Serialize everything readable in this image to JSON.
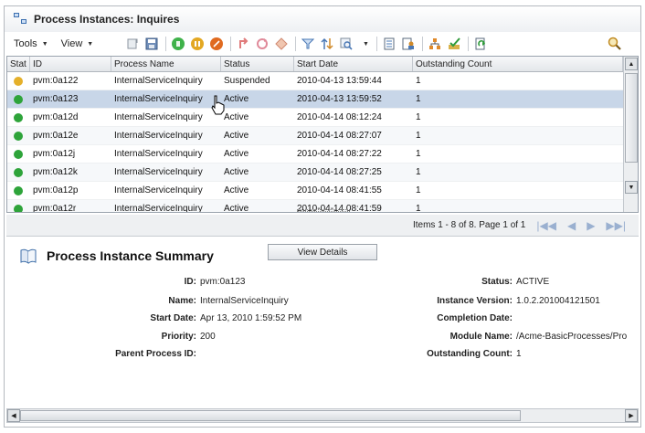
{
  "window": {
    "title": "Process Instances: Inquires"
  },
  "toolbar": {
    "tools_label": "Tools",
    "view_label": "View"
  },
  "grid": {
    "columns": [
      "Stat",
      "ID",
      "Process Name",
      "Status",
      "Start Date",
      "Outstanding Count"
    ],
    "rows": [
      {
        "id": "pvm:0a122",
        "name": "InternalServiceInquiry",
        "status": "Suspended",
        "start": "2010-04-13 13:59:44",
        "count": "1",
        "color": "#e5b02a"
      },
      {
        "id": "pvm:0a123",
        "name": "InternalServiceInquiry",
        "status": "Active",
        "start": "2010-04-13 13:59:52",
        "count": "1",
        "color": "#2ea43a"
      },
      {
        "id": "pvm:0a12d",
        "name": "InternalServiceInquiry",
        "status": "Active",
        "start": "2010-04-14 08:12:24",
        "count": "1",
        "color": "#2ea43a"
      },
      {
        "id": "pvm:0a12e",
        "name": "InternalServiceInquiry",
        "status": "Active",
        "start": "2010-04-14 08:27:07",
        "count": "1",
        "color": "#2ea43a"
      },
      {
        "id": "pvm:0a12j",
        "name": "InternalServiceInquiry",
        "status": "Active",
        "start": "2010-04-14 08:27:22",
        "count": "1",
        "color": "#2ea43a"
      },
      {
        "id": "pvm:0a12k",
        "name": "InternalServiceInquiry",
        "status": "Active",
        "start": "2010-04-14 08:27:25",
        "count": "1",
        "color": "#2ea43a"
      },
      {
        "id": "pvm:0a12p",
        "name": "InternalServiceInquiry",
        "status": "Active",
        "start": "2010-04-14 08:41:55",
        "count": "1",
        "color": "#2ea43a"
      },
      {
        "id": "pvm:0a12r",
        "name": "InternalServiceInquiry",
        "status": "Active",
        "start": "2010-04-14 08:41:59",
        "count": "1",
        "color": "#2ea43a"
      }
    ]
  },
  "pager": {
    "text": "Items 1 - 8 of 8. Page 1 of 1"
  },
  "summary": {
    "title": "Process Instance Summary",
    "view_details": "View Details",
    "left": [
      {
        "label": "ID:",
        "value": "pvm:0a123"
      },
      {
        "label": "Name:",
        "value": "InternalServiceInquiry"
      },
      {
        "label": "Start Date:",
        "value": "Apr 13, 2010 1:59:52 PM"
      },
      {
        "label": "Priority:",
        "value": "200"
      },
      {
        "label": "Parent Process ID:",
        "value": ""
      }
    ],
    "right": [
      {
        "label": "Status:",
        "value": "ACTIVE"
      },
      {
        "label": "Instance Version:",
        "value": "1.0.2.201004121501"
      },
      {
        "label": "Completion Date:",
        "value": ""
      },
      {
        "label": "Module Name:",
        "value": "/Acme-BasicProcesses/Pro"
      },
      {
        "label": "Outstanding Count:",
        "value": "1"
      }
    ]
  },
  "colors": {
    "selected_row": "#c8d6e8",
    "active": "#2ea43a",
    "suspended": "#e5b02a"
  }
}
